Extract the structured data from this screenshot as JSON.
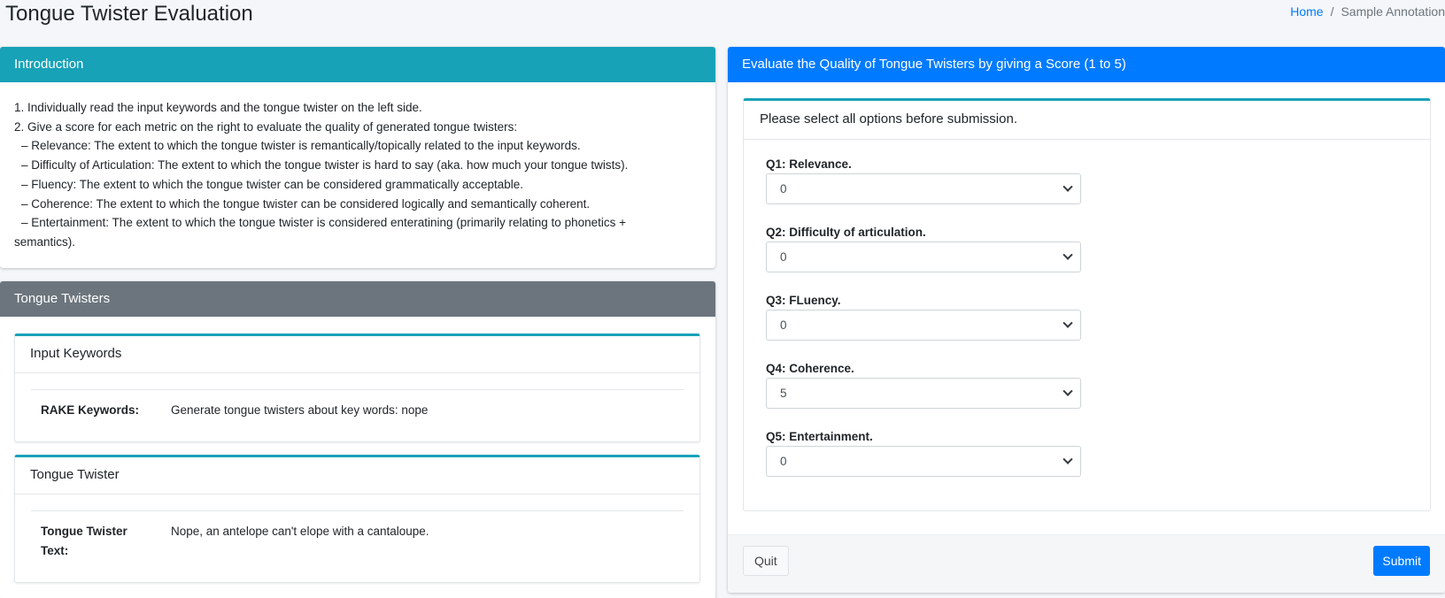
{
  "page": {
    "title": "Tongue Twister Evaluation"
  },
  "breadcrumb": {
    "home": "Home",
    "separator": "/",
    "current": "Sample Annotation"
  },
  "intro": {
    "header": "Introduction",
    "lines": [
      "1. Individually read the input keywords and the tongue twister on the left side.",
      "2. Give a score for each metric on the right to evaluate the quality of generated tongue twisters:",
      "–  Relevance: The extent to which the tongue twister is remantically/topically related to the input keywords.",
      "–  Difficulty of Articulation: The extent to which the tongue twister is hard to say (aka. how much your tongue twists).",
      "–  Fluency: The extent to which the tongue twister can be considered grammatically acceptable.",
      "–  Coherence: The extent to which the tongue twister can be considered logically and semantically coherent.",
      "–  Entertainment: The extent to which the tongue twister is considered enteratining (primarily relating to phonetics +",
      "semantics)."
    ]
  },
  "twisters": {
    "header": "Tongue Twisters",
    "input": {
      "title": "Input Keywords",
      "key": "RAKE Keywords:",
      "value": "Generate tongue twisters about key words: nope"
    },
    "twister": {
      "title": "Tongue Twister",
      "key_line1": "Tongue Twister",
      "key_line2": "Text:",
      "value": "Nope, an antelope can't elope with a cantaloupe."
    }
  },
  "eval": {
    "header": "Evaluate the Quality of Tongue Twisters by giving a Score (1 to 5)",
    "note": "Please select all options before submission.",
    "questions": [
      {
        "label": "Q1: Relevance.",
        "value": "0"
      },
      {
        "label": "Q2: Difficulty of articulation.",
        "value": "0"
      },
      {
        "label": "Q3: FLuency.",
        "value": "0"
      },
      {
        "label": "Q4: Coherence.",
        "value": "5"
      },
      {
        "label": "Q5: Entertainment.",
        "value": "0"
      }
    ],
    "quit": "Quit",
    "submit": "Submit"
  },
  "colors": {
    "info": "#17a2b8",
    "secondary": "#6c757d",
    "primary": "#007bff"
  }
}
